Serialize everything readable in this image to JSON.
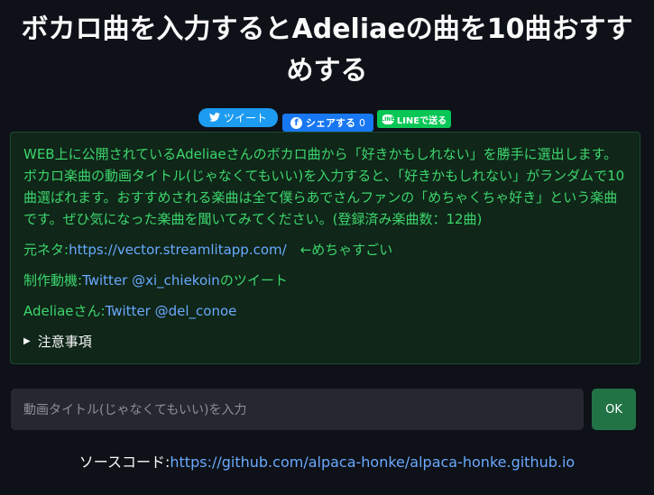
{
  "title": {
    "line1": "ボカロ曲を入力するとAdeliaeの曲を10曲おすす",
    "line2": "めする"
  },
  "share": {
    "tweet_label": "ツイート",
    "facebook_label": "シェアする",
    "facebook_count": "0",
    "line_label": "LINEで送る",
    "line_icon_text": "LINE"
  },
  "info": {
    "description": "WEB上に公開されているAdeliaeさんのボカロ曲から「好きかもしれない」を勝手に選出します。ボカロ楽曲の動画タイトル(じゃなくてもいい)を入力すると、「好きかもしれない」がランダムで10曲選ばれます。おすすめされる楽曲は全て僕らあでさんファンの「めちゃくちゃ好き」という楽曲です。ぜひ気になった楽曲を聞いてみてください。(登録済み楽曲数：12曲)",
    "origin_prefix": "元ネタ:",
    "origin_link": "https://vector.streamlitapp.com/",
    "origin_suffix": "　←めちゃすごい",
    "motive_prefix": "制作動機:",
    "motive_link": "Twitter @xi_chiekoin",
    "motive_suffix": "のツイート",
    "adeliae_prefix": "Adeliaeさん:",
    "adeliae_link": "Twitter @del_conoe",
    "details_label": "注意事項"
  },
  "search": {
    "placeholder": "動画タイトル(じゃなくてもいい)を入力",
    "ok_label": "OK"
  },
  "footer": {
    "source_prefix": "ソースコード:",
    "source_link": "https://github.com/alpaca-honke/alpaca-honke.github.io"
  }
}
